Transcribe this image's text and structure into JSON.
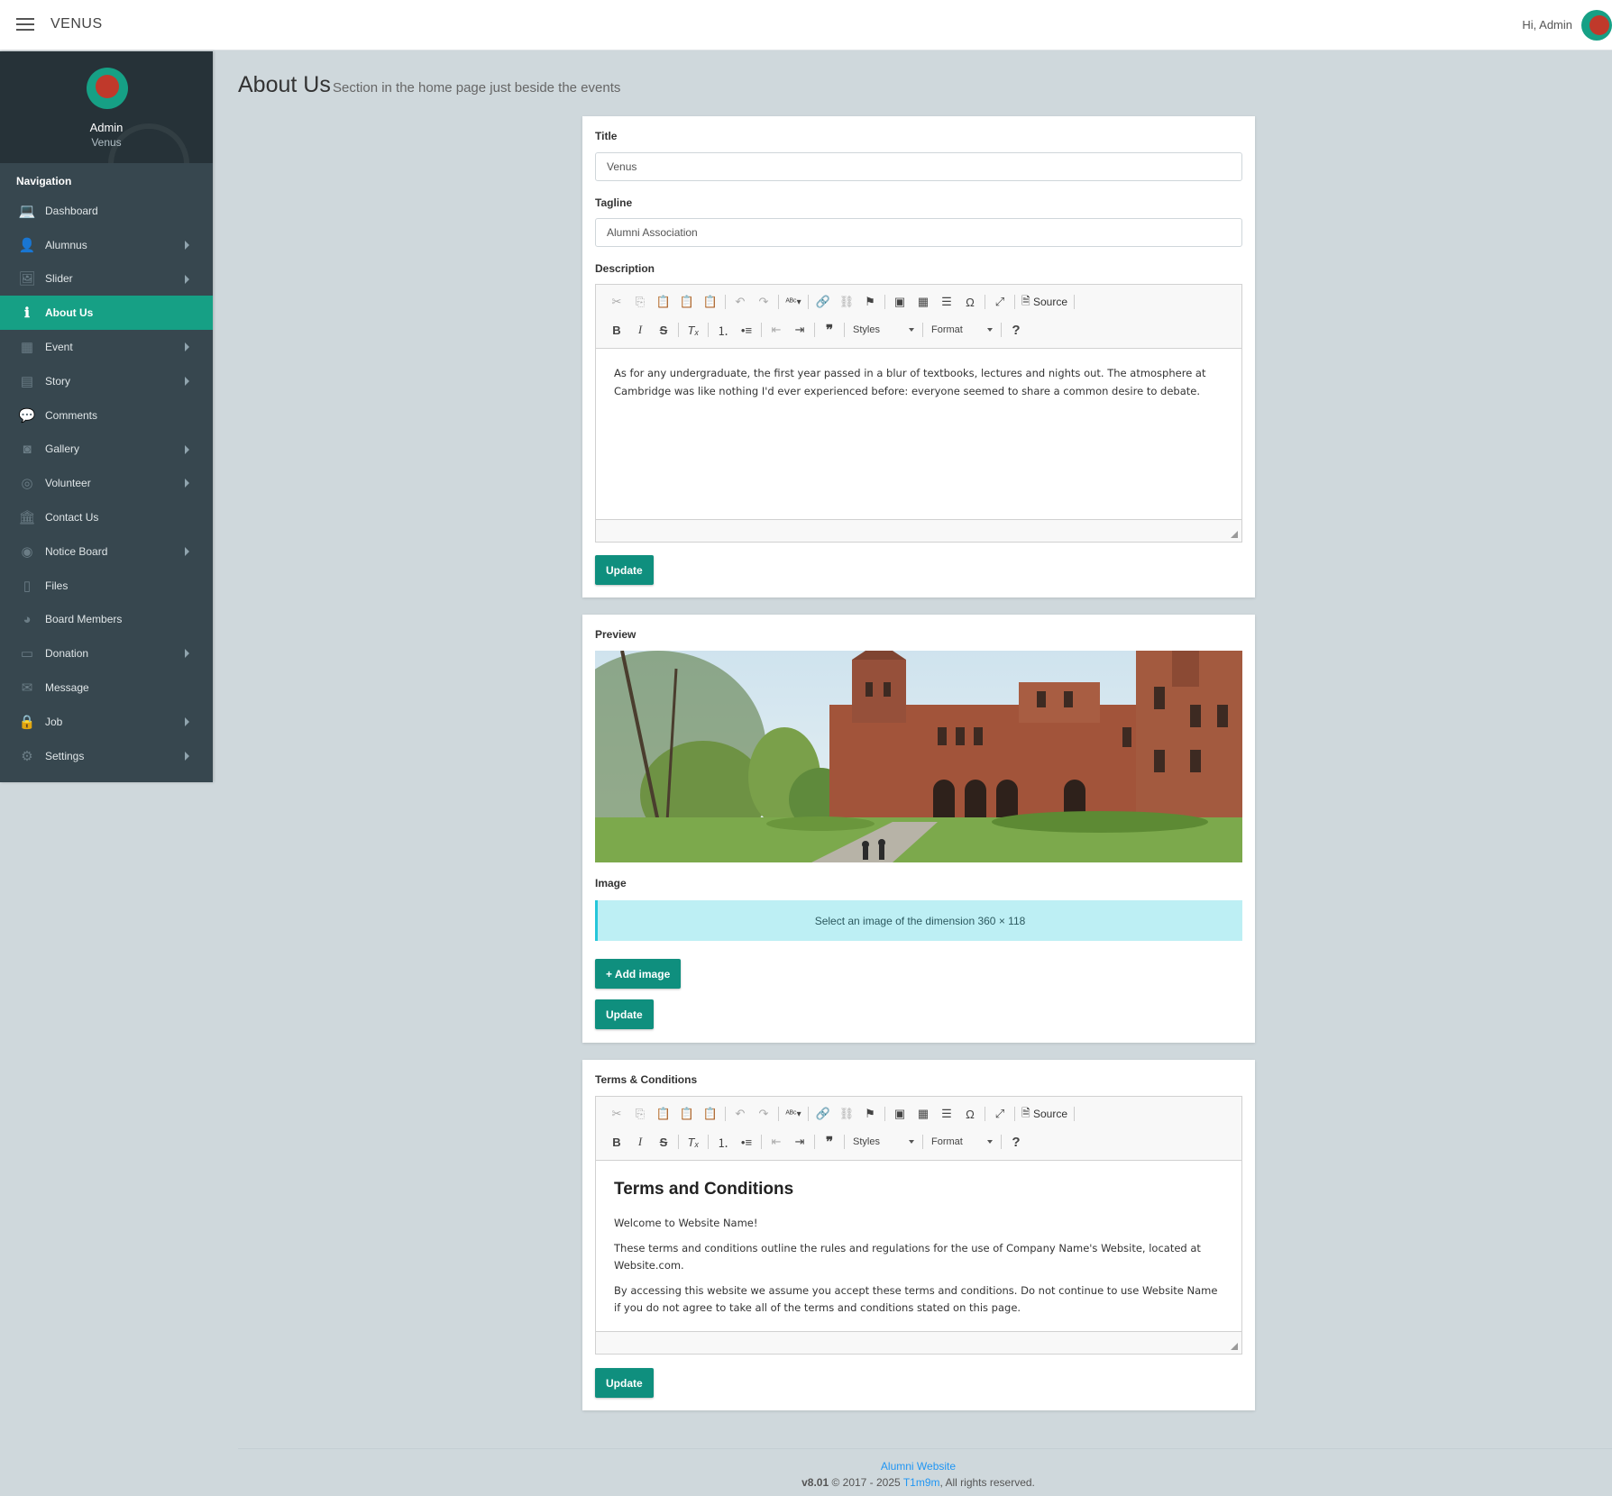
{
  "app": {
    "brand": "VENUS",
    "greeting": "Hi, Admin"
  },
  "profile": {
    "name": "Admin",
    "org": "Venus"
  },
  "nav": {
    "title": "Navigation",
    "items": [
      {
        "label": "Dashboard",
        "icon": "laptop-icon",
        "arrow": false
      },
      {
        "label": "Alumnus",
        "icon": "user-icon",
        "arrow": true
      },
      {
        "label": "Slider",
        "icon": "image-icon",
        "arrow": true
      },
      {
        "label": "About Us",
        "icon": "info-icon",
        "arrow": false,
        "active": true
      },
      {
        "label": "Event",
        "icon": "calendar-icon",
        "arrow": true
      },
      {
        "label": "Story",
        "icon": "book-icon",
        "arrow": true
      },
      {
        "label": "Comments",
        "icon": "comments-icon",
        "arrow": false
      },
      {
        "label": "Gallery",
        "icon": "camera-icon",
        "arrow": true
      },
      {
        "label": "Volunteer",
        "icon": "life-ring-icon",
        "arrow": true
      },
      {
        "label": "Contact Us",
        "icon": "bank-icon",
        "arrow": false
      },
      {
        "label": "Notice Board",
        "icon": "podcast-icon",
        "arrow": true
      },
      {
        "label": "Files",
        "icon": "file-icon",
        "arrow": false
      },
      {
        "label": "Board Members",
        "icon": "user-circle-icon",
        "arrow": false
      },
      {
        "label": "Donation",
        "icon": "credit-card-icon",
        "arrow": true
      },
      {
        "label": "Message",
        "icon": "envelope-icon",
        "arrow": false
      },
      {
        "label": "Job",
        "icon": "lock-icon",
        "arrow": true
      },
      {
        "label": "Settings",
        "icon": "gear-icon",
        "arrow": true
      }
    ]
  },
  "page": {
    "title": "About Us",
    "subtitle": "Section in the home page just beside the events"
  },
  "about": {
    "title_label": "Title",
    "title_value": "Venus",
    "tagline_label": "Tagline",
    "tagline_value": "Alumni Association",
    "description_label": "Description",
    "description_text": "As for any undergraduate, the first year passed in a blur of textbooks, lectures and nights out. The atmosphere at Cambridge was like nothing I'd ever experienced before: everyone seemed to share a common desire to debate.",
    "update_label": "Update"
  },
  "editor": {
    "source_label": "Source",
    "styles_label": "Styles",
    "format_label": "Format",
    "help_label": "?"
  },
  "image_card": {
    "preview_label": "Preview",
    "image_label": "Image",
    "alert_text": "Select an image of the dimension 360 × 118",
    "add_image_label": "+ Add image",
    "update_label": "Update"
  },
  "terms": {
    "label": "Terms & Conditions",
    "heading": "Terms and Conditions",
    "p1": "Welcome to Website Name!",
    "p2": "These terms and conditions outline the rules and regulations for the use of Company Name's Website, located at Website.com.",
    "p3": "By accessing this website we assume you accept these terms and conditions. Do not continue to use Website Name if you do not agree to take all of the terms and conditions stated on this page.",
    "update_label": "Update"
  },
  "footer": {
    "site_link": "Alumni Website",
    "version": "v8.01",
    "copyright_pre": " © 2017 - 2025 ",
    "author_link": "T1m9m",
    "copyright_post": ", All rights reserved."
  },
  "colors": {
    "accent": "#0f8f7e",
    "sidebar": "#37474f",
    "sidebar_header": "#263238",
    "background": "#cfd8dc",
    "link": "#2196f3",
    "alert": "#bdeff4"
  }
}
